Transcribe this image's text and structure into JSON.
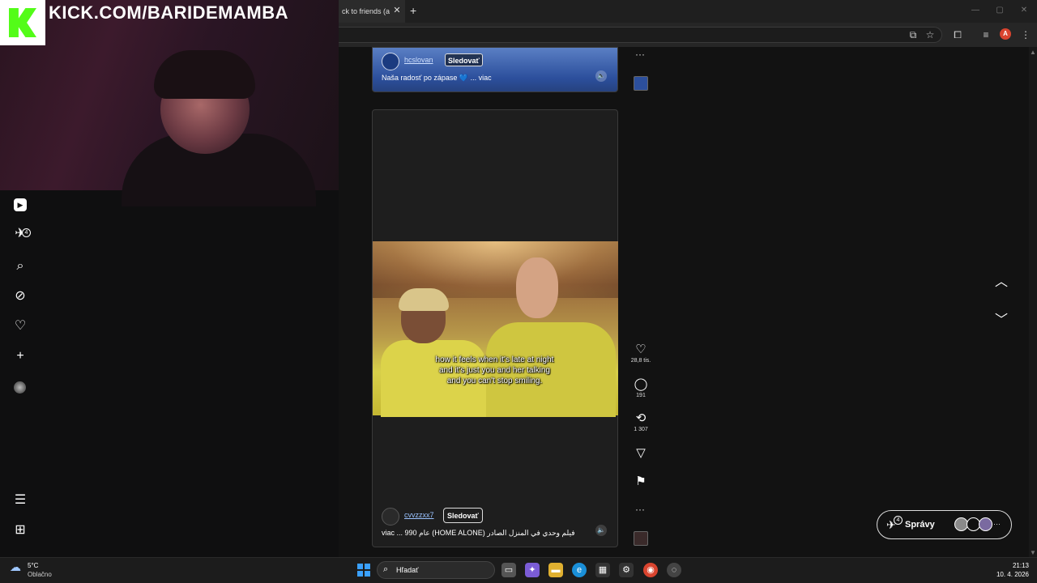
{
  "stream": {
    "overlay_url": "KICK.COM/BARIDEMAMBA"
  },
  "browser": {
    "tab_title": "ck to friends (a",
    "tab_close": "✕",
    "new_tab": "+",
    "profile_letter": "A"
  },
  "left_nav": {
    "badge_count": "4"
  },
  "feed": {
    "post1": {
      "username": "hcslovan",
      "follow_label": "Sledovať",
      "caption": "Naša radosť po zápase 💙 ... viac"
    },
    "post2": {
      "subtitle": "how it feels when it's late at night and it's just you and her talking and you can't stop smiling.",
      "username": "cvvzzxx7",
      "follow_label": "Sledovať",
      "caption": "viac ... 990 عام (HOME ALONE) فيلم وحدي في المنزل الصادر",
      "likes": "28,8 tis.",
      "comments": "191",
      "reposts": "1 307"
    }
  },
  "messages": {
    "label": "Správy",
    "badge_count": "4"
  },
  "taskbar": {
    "weather_temp": "5°C",
    "weather_desc": "Oblačno",
    "search_label": "Hľadať",
    "time": "21:13",
    "date": "10. 4. 2026"
  }
}
